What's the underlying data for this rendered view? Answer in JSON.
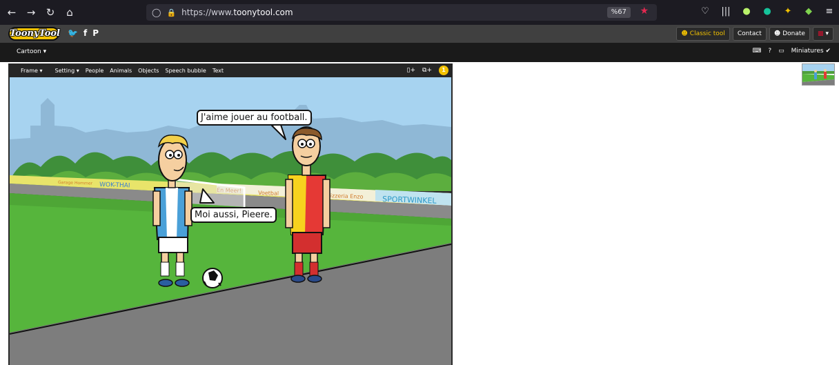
{
  "browser": {
    "url_prefix": "https://www.",
    "url_domain": "toonytool.com",
    "zoom": "%67"
  },
  "site": {
    "logo": "ToonyTool",
    "classic_tool": "Classic tool",
    "contact": "Contact",
    "donate": "Donate"
  },
  "toolbar": {
    "cartoon": "Cartoon",
    "miniatures": "Miniatures"
  },
  "editor": {
    "menu": [
      "Frame",
      "Setting",
      "People",
      "Animals",
      "Objects",
      "Speech bubble",
      "Text"
    ],
    "frame_count": "1"
  },
  "scene": {
    "bubble1": "J'aime jouer au football.",
    "bubble2": "Moi aussi, Pieere.",
    "banners": [
      "Garage Hommer",
      "WOK-THAI",
      "En Meer!",
      "Voetbal",
      "Pizzeria Enzo",
      "SPORTWINKEL"
    ]
  }
}
